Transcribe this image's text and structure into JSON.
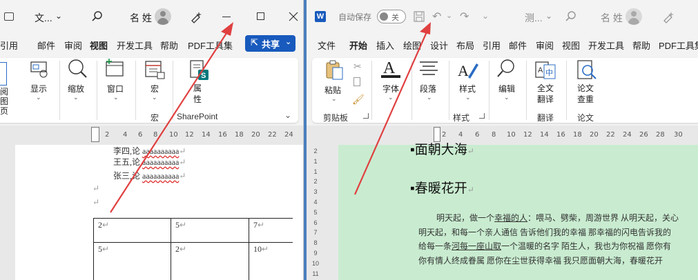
{
  "left_window": {
    "title": "文...",
    "user_name": "名 姓",
    "tabs": [
      "引用",
      "邮件",
      "审阅",
      "视图",
      "开发工具",
      "帮助",
      "PDF工具集"
    ],
    "active_tab": "视图",
    "share_label": "共享",
    "ribbon": {
      "items": [
        {
          "label": "显示"
        },
        {
          "label": "缩放"
        },
        {
          "label": "窗口"
        },
        {
          "label": "宏"
        },
        {
          "label": "属\n性"
        }
      ],
      "partial_label": "阅\n图\n页",
      "groups": [
        "宏",
        "SharePoint"
      ]
    },
    "ruler_numbers": [
      "2",
      "4",
      "6",
      "8",
      "10",
      "12",
      "14",
      "16",
      "18",
      "20",
      "22",
      "24",
      "26",
      "28"
    ],
    "doc_lines": [
      {
        "name": "李四,论",
        "text": "aaaaaaaaaa"
      },
      {
        "name": "王五,论",
        "text": "aaaaaaaaaa"
      },
      {
        "name": "张三,论",
        "text": "aaaaaaaaaa"
      }
    ],
    "table": [
      [
        "2",
        "5",
        "7"
      ],
      [
        "5",
        "2",
        "10"
      ]
    ]
  },
  "right_window": {
    "autosave_label": "自动保存",
    "autosave_state": "关",
    "doc_title": "测...",
    "user_name": "名 姓",
    "tabs": [
      "文件",
      "开始",
      "插入",
      "绘图",
      "设计",
      "布局",
      "引用",
      "邮件",
      "审阅",
      "视图",
      "开发工具",
      "帮助",
      "PDF工具集"
    ],
    "active_tab": "开始",
    "ribbon": {
      "items": [
        {
          "label": "粘贴"
        },
        {
          "label": "字体"
        },
        {
          "label": "段落"
        },
        {
          "label": "样式"
        },
        {
          "label": "编辑"
        },
        {
          "label": "全文\n翻译"
        },
        {
          "label": "论文\n查重"
        }
      ],
      "groups": [
        "剪贴板",
        "样式",
        "翻译",
        "论文"
      ]
    },
    "ruler_numbers": [
      "2",
      "4",
      "6",
      "8",
      "10",
      "12",
      "14",
      "16",
      "18",
      "20",
      "22",
      "24",
      "26",
      "28",
      "30"
    ],
    "vruler_numbers": [
      "2",
      "1",
      "1",
      "2",
      "3",
      "4",
      "5",
      "6",
      "7",
      "8",
      "9",
      "10",
      "11"
    ],
    "heading_top": "面朝大海",
    "heading_main": "春暖花开",
    "body_lines": [
      [
        "明天起，做一个",
        "幸福的人",
        "：喂马、劈柴，周游世界  从明天起，关心"
      ],
      [
        "明天起，和每一个亲人通信  告诉他们我的幸福  那幸福的闪电告诉我的"
      ],
      [
        "给每一条",
        "河每一座山取",
        "一个温暖的名字  陌生人，我也为你祝福  愿你有"
      ],
      [
        "你有情人终成眷属  愿你在尘世获得幸福  我只愿面朝大海，春暖花开"
      ]
    ]
  },
  "colors": {
    "accent": "#185abd",
    "arrow": "#e04040",
    "page_green": "#c9ecd0",
    "titlebar": "#f3f3f3"
  }
}
